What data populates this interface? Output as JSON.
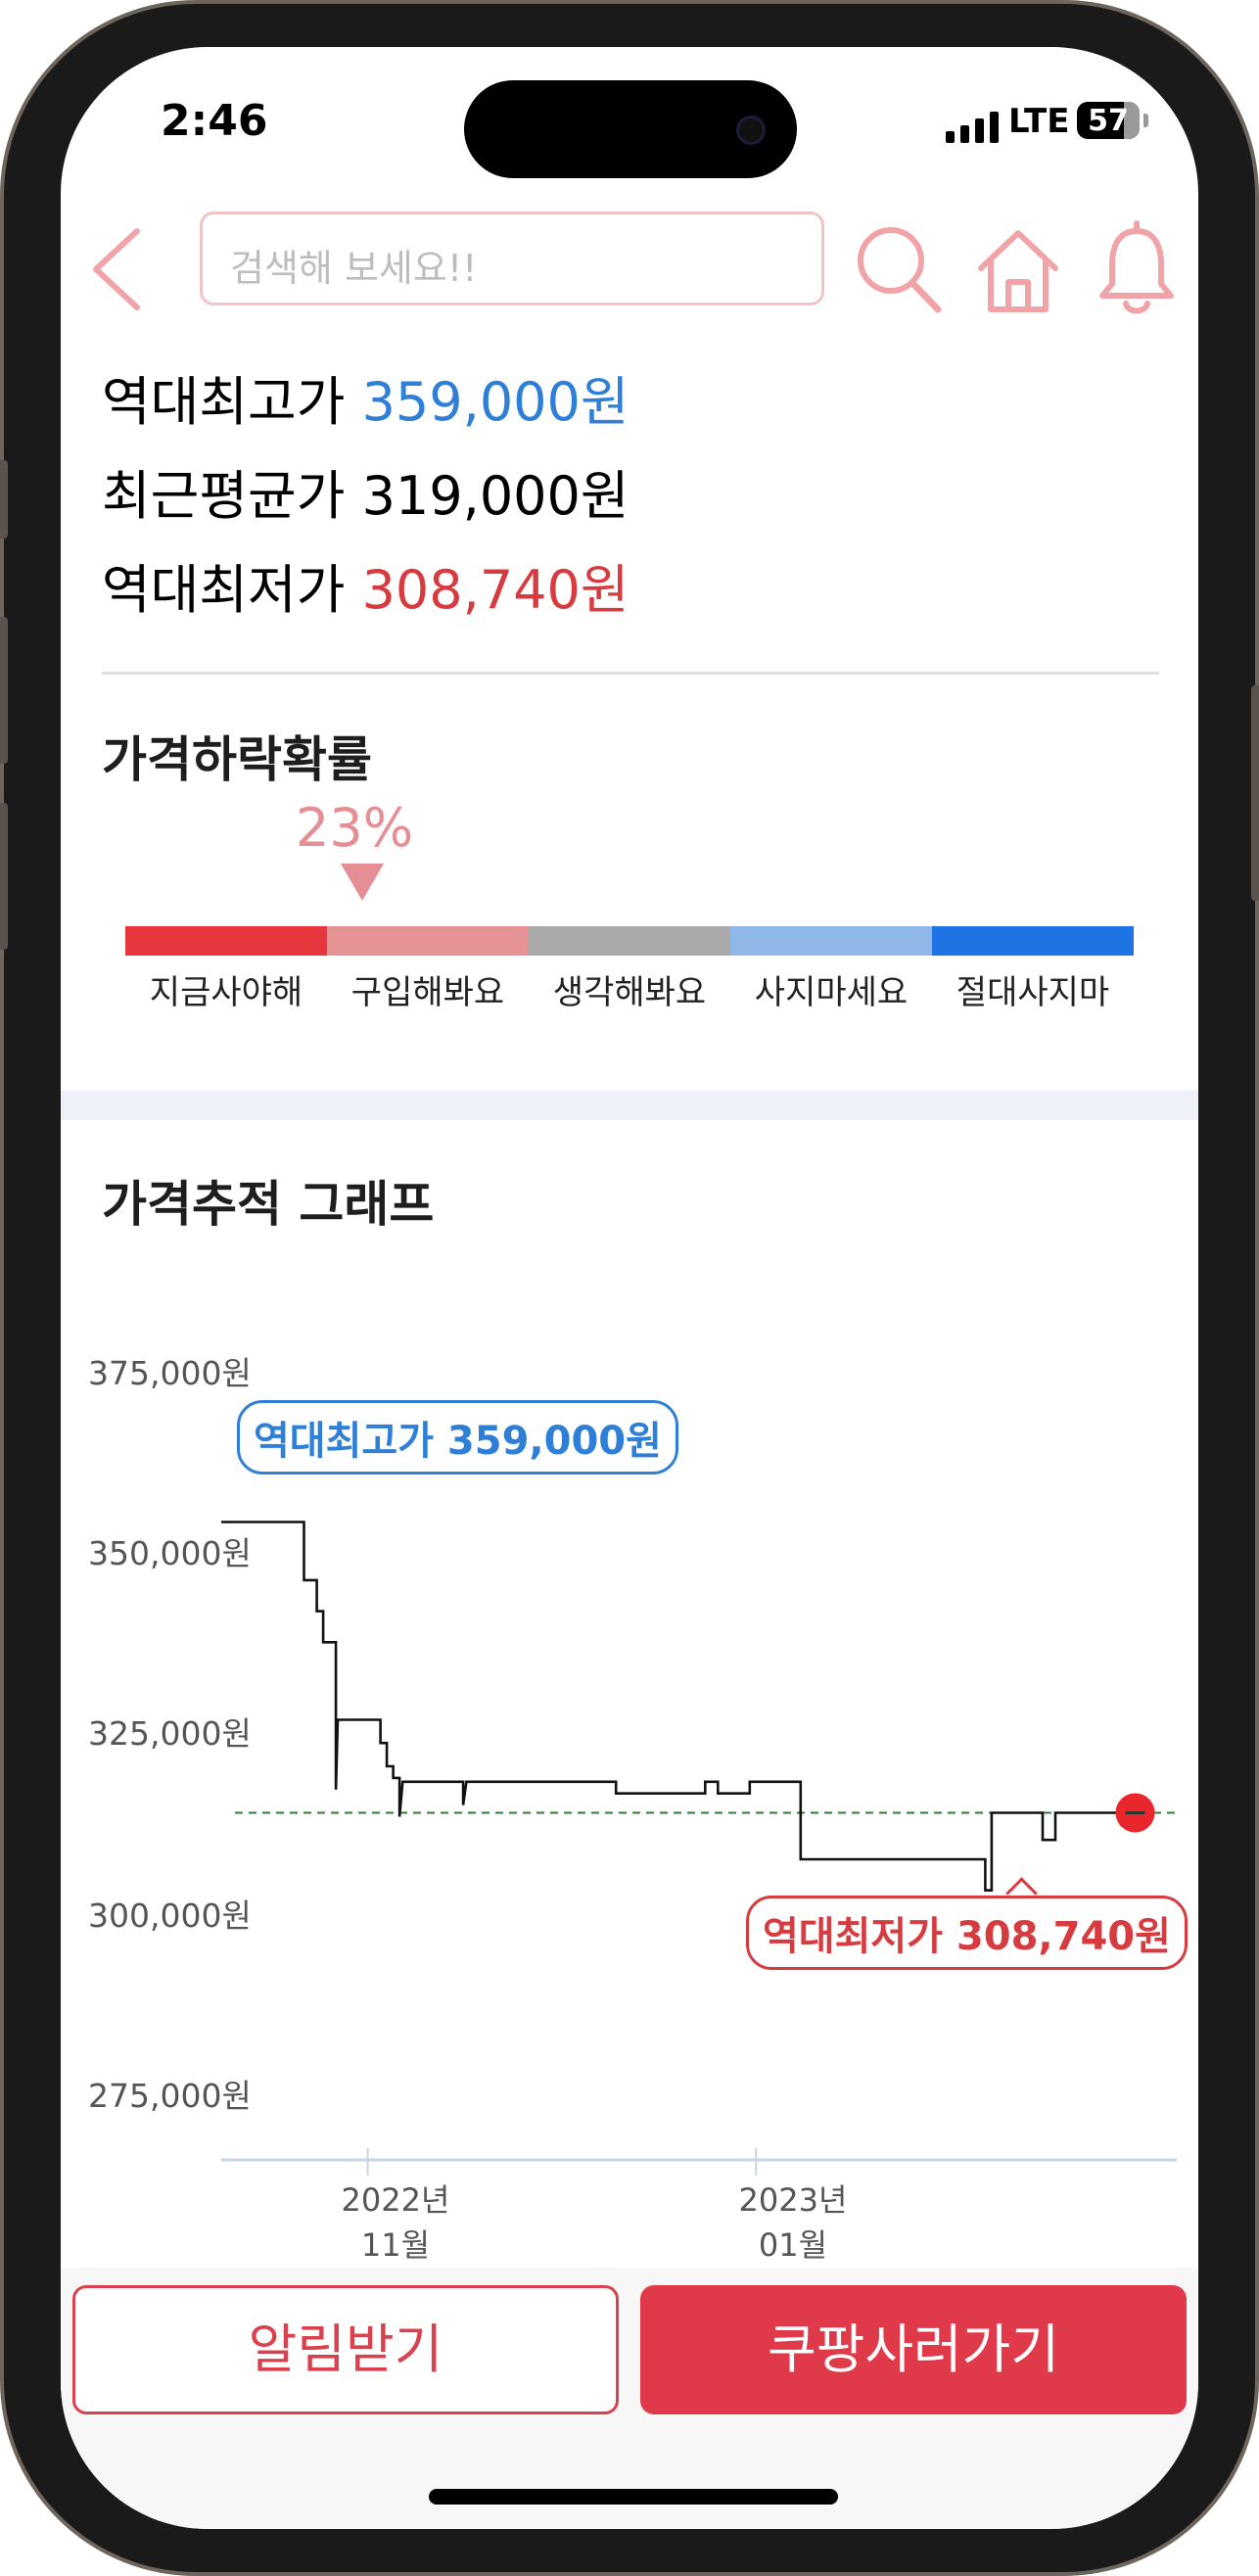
{
  "status_bar": {
    "time": "2:46",
    "network": "LTE",
    "battery": "57"
  },
  "header": {
    "search_placeholder": "검색해 보세요!!",
    "icons": [
      "back-icon",
      "search-icon",
      "home-icon",
      "bell-icon"
    ]
  },
  "summary": {
    "max_label": "역대최고가",
    "max_value": "359,000원",
    "avg_label": "최근평균가",
    "avg_value": "319,000원",
    "min_label": "역대최저가",
    "min_value": "308,740원"
  },
  "probability": {
    "title": "가격하락확률",
    "value": "23%",
    "segments": [
      {
        "label": "지금사야해",
        "color": "#e8363f"
      },
      {
        "label": "구입해봐요",
        "color": "#e69396"
      },
      {
        "label": "생각해봐요",
        "color": "#aaaaaa"
      },
      {
        "label": "사지마세요",
        "color": "#8fb8e8"
      },
      {
        "label": "절대사지마",
        "color": "#1e74e5"
      }
    ]
  },
  "graph": {
    "title": "가격추적 그래프",
    "max_callout": "역대최고가 359,000원",
    "min_callout": "역대최저가 308,740원"
  },
  "chart_data": {
    "type": "line",
    "title": "가격추적 그래프",
    "y_tick_labels": [
      "375,000원",
      "350,000원",
      "325,000원",
      "300,000원",
      "275,000원"
    ],
    "y_ticks": [
      375000,
      350000,
      325000,
      300000,
      275000
    ],
    "ylim": [
      275000,
      375000
    ],
    "x_tick_labels": [
      [
        "2022년",
        "11월"
      ],
      [
        "2023년",
        "01월"
      ]
    ],
    "x_ticks": [
      25,
      86
    ],
    "xlim": [
      2,
      145
    ],
    "average_line": 319000,
    "grid": false,
    "series": [
      {
        "values": [
          [
            2,
            356500
          ],
          [
            15,
            356500
          ],
          [
            15,
            349000
          ],
          [
            17,
            349000
          ],
          [
            17,
            345000
          ],
          [
            18,
            345000
          ],
          [
            18,
            341000
          ],
          [
            20,
            341000
          ],
          [
            20,
            322000
          ],
          [
            20.3,
            331000
          ],
          [
            27,
            331000
          ],
          [
            27,
            328000
          ],
          [
            28,
            328000
          ],
          [
            28,
            325000
          ],
          [
            29,
            325000
          ],
          [
            29,
            323500
          ],
          [
            30,
            323500
          ],
          [
            30,
            318500
          ],
          [
            30.5,
            323000
          ],
          [
            40,
            323000
          ],
          [
            40,
            320000
          ],
          [
            40.5,
            323000
          ],
          [
            64,
            323000
          ],
          [
            64,
            321500
          ],
          [
            78,
            321500
          ],
          [
            78,
            323000
          ],
          [
            80,
            323000
          ],
          [
            80,
            321500
          ],
          [
            85,
            321500
          ],
          [
            85,
            323000
          ],
          [
            93,
            323000
          ],
          [
            93,
            313000
          ],
          [
            122,
            313000
          ],
          [
            122,
            309000
          ],
          [
            123,
            309000
          ],
          [
            123,
            319000
          ],
          [
            131,
            319000
          ],
          [
            131,
            315500
          ],
          [
            133,
            315500
          ],
          [
            133,
            319000
          ],
          [
            144,
            319000
          ]
        ]
      }
    ],
    "points": [
      {
        "label": "역대최고가",
        "value": 359000
      },
      {
        "label": "역대최저가",
        "value": 308740
      }
    ]
  },
  "buttons": {
    "alert_label": "알림받기",
    "buy_label": "쿠팡사러가기"
  }
}
